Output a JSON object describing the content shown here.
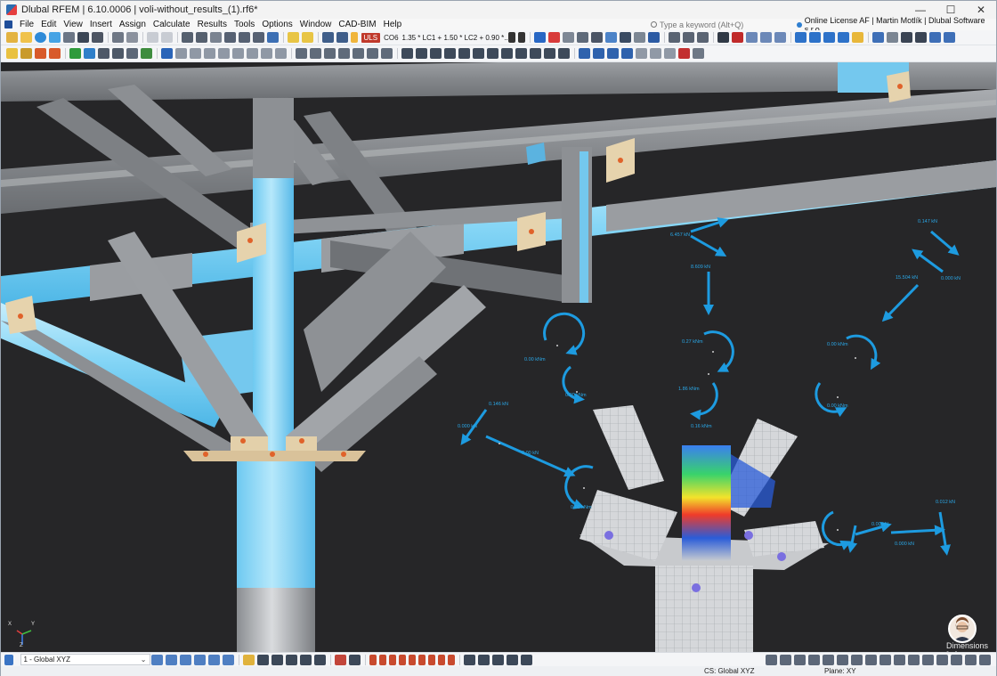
{
  "window": {
    "title": "Dlubal RFEM | 6.10.0006 | voli-without_results_(1).rf6*",
    "controls": {
      "minimize": "—",
      "maximize": "☐",
      "close": "✕"
    }
  },
  "menu": {
    "items": [
      "File",
      "Edit",
      "View",
      "Insert",
      "Assign",
      "Calculate",
      "Results",
      "Tools",
      "Options",
      "Window",
      "CAD-BIM",
      "Help"
    ],
    "search_placeholder": "Type a keyword (Alt+Q)",
    "license": "Online License AF | Martin Motlík | Dlubal Software s.r.o."
  },
  "toolbar": {
    "design_situation": "ULS",
    "combination": "CO6",
    "combination_formula": "1.35 * LC1 + 1.50 * LC2 + 0.90 *..."
  },
  "viewport": {
    "force_labels": [
      "6.457 kN",
      "0.147 kN",
      "0.000 kN",
      "8.609 kN",
      "15.504 kN",
      "0.00 kNm",
      "0.27 kNm",
      "0.00 kNm",
      "0.00 kNm",
      "1.86 kNm",
      "0.00 kNm",
      "0.146 kN",
      "0.000 kN",
      "0.16 kNm",
      "0.00 kN",
      "0.00 kNm",
      "0.00 kN",
      "0.000 kN",
      "0.012 kN"
    ],
    "dimensions_label": "Dimensions [m]",
    "axes": {
      "x": "X",
      "y": "Y",
      "z": "Z"
    }
  },
  "bottom": {
    "view_select": "1 - Global XYZ"
  },
  "status": {
    "cs": "CS: Global XYZ",
    "plane": "Plane: XY"
  },
  "colors": {
    "background": "#262628",
    "steel": "#8c8f93",
    "highlight": "#7fd3f5",
    "force": "#1d9be0",
    "plate": "#d9c29a",
    "bolt": "#e0622a"
  }
}
